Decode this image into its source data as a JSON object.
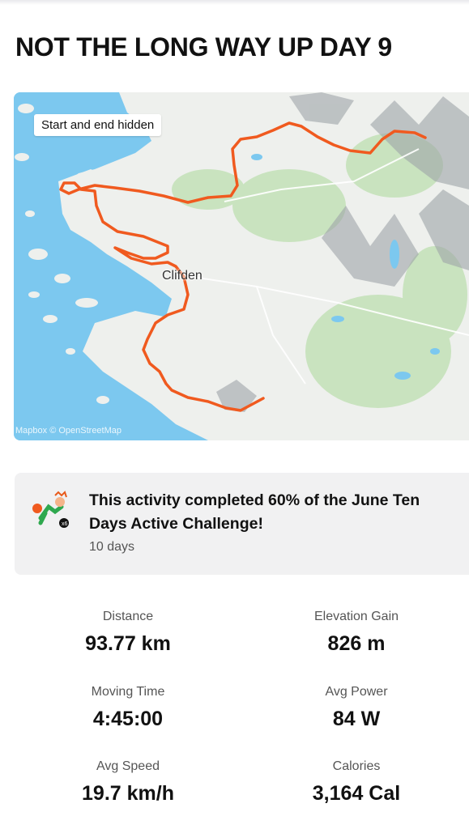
{
  "activity": {
    "title": "NOT THE LONG WAY UP DAY 9"
  },
  "map": {
    "badge_text": "Start and end hidden",
    "place_label": "Clifden",
    "attribution": "Mapbox © OpenStreetMap",
    "route_color": "#f05a1f",
    "sea_color": "#7cc8ef",
    "land_color": "#eef0ed",
    "park_color": "#c9e3bf",
    "mountain_color": "#9ea4a8"
  },
  "challenge": {
    "icon": "challenge-badge-icon",
    "text": "This activity completed 60% of the June Ten Days Active Challenge!",
    "subtext": "10 days"
  },
  "stats": [
    {
      "label": "Distance",
      "value": "93.77 km"
    },
    {
      "label": "Elevation Gain",
      "value": "826 m"
    },
    {
      "label": "Moving Time",
      "value": "4:45:00"
    },
    {
      "label": "Avg Power",
      "value": "84 W"
    },
    {
      "label": "Avg Speed",
      "value": "19.7 km/h"
    },
    {
      "label": "Calories",
      "value": "3,164 Cal"
    }
  ]
}
